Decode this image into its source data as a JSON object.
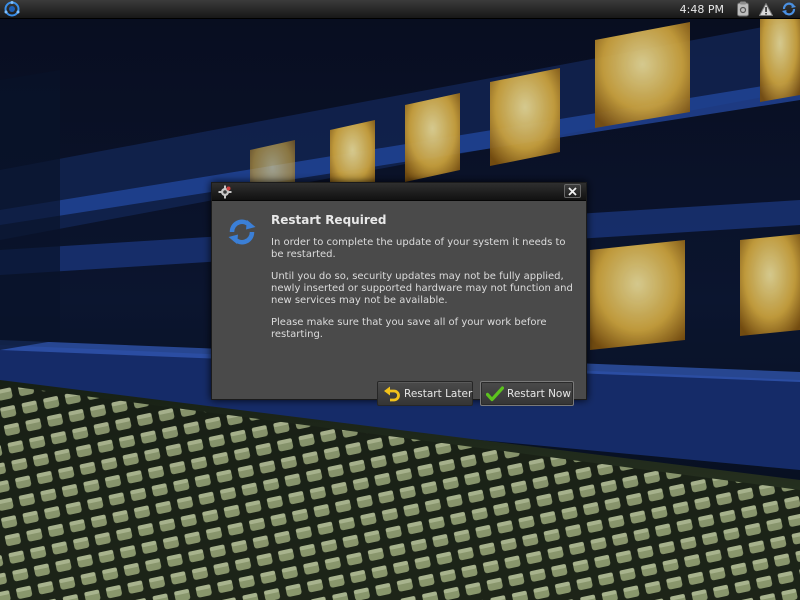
{
  "panel": {
    "clock": "4:48 PM",
    "icons": [
      "main-menu-icon",
      "clipboard-icon",
      "warning-icon",
      "update-icon"
    ]
  },
  "dialog": {
    "title_icon": "gear-icon",
    "close_icon": "close-icon",
    "icon": "refresh-icon",
    "heading": "Restart Required",
    "paragraphs": [
      "In order to complete the update of your system it needs to be restarted.",
      "Until you do so, security updates may not be fully applied, newly inserted or supported hardware may not function and new services may not be available.",
      "Please make sure that you save all of your work before restarting."
    ],
    "buttons": {
      "restart_later": "Restart Later",
      "restart_now": "Restart Now"
    }
  },
  "colors": {
    "panel": "#1e1e1e",
    "dialog_bg": "#4a4a4a",
    "accent_blue": "#3b7fd6",
    "ok_green": "#5cc21e"
  }
}
